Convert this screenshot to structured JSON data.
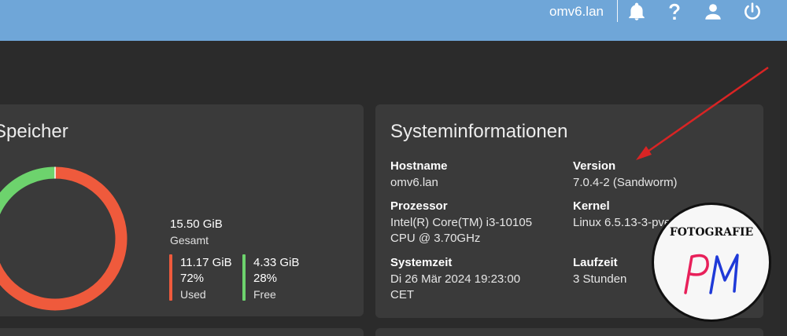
{
  "header": {
    "hostname": "omv6.lan",
    "icons": [
      "bell-icon",
      "help-icon",
      "user-icon",
      "power-icon"
    ]
  },
  "storage": {
    "title": "Speicher",
    "total_value": "15.50 GiB",
    "total_label": "Gesamt",
    "used_value": "11.17 GiB",
    "used_percent": "72%",
    "used_label": "Used",
    "free_value": "4.33 GiB",
    "free_percent": "28%",
    "free_label": "Free",
    "used_fraction": 0.72,
    "colors": {
      "used": "#ef5a3c",
      "free": "#6dd36d"
    }
  },
  "sysinfo": {
    "title": "Systeminformationen",
    "hostname_label": "Hostname",
    "hostname_value": "omv6.lan",
    "version_label": "Version",
    "version_value": "7.0.4-2 (Sandworm)",
    "processor_label": "Prozessor",
    "processor_line1": "Intel(R) Core(TM) i3-10105",
    "processor_line2": "CPU @ 3.70GHz",
    "kernel_label": "Kernel",
    "kernel_value": "Linux 6.5.13-3-pve",
    "systemtime_label": "Systemzeit",
    "systemtime_line1": "Di 26 Mär 2024 19:23:00",
    "systemtime_line2": "CET",
    "uptime_label": "Laufzeit",
    "uptime_value": "3 Stunden"
  },
  "watermark": {
    "text": "FOTOGRAFIE",
    "initials": "PM"
  }
}
